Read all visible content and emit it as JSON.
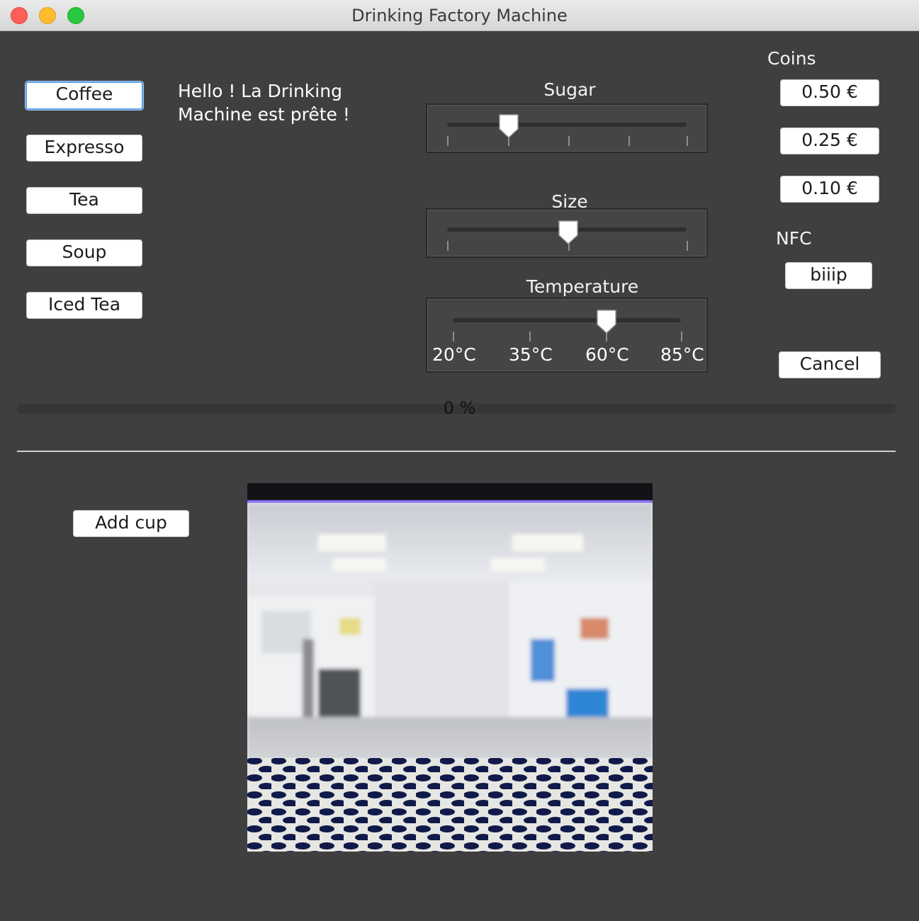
{
  "window": {
    "title": "Drinking Factory Machine"
  },
  "drinks": [
    "Coffee",
    "Expresso",
    "Tea",
    "Soup",
    "Iced Tea"
  ],
  "message": {
    "line1": "Hello ! La Drinking",
    "line2": "Machine est prête !"
  },
  "sliders": {
    "sugar": {
      "label": "Sugar",
      "value": 1,
      "min": 0,
      "max": 4
    },
    "size": {
      "label": "Size",
      "value": 1,
      "min": 0,
      "max": 2
    },
    "temperature": {
      "label": "Temperature",
      "value": 2,
      "min": 0,
      "max": 3,
      "tick_labels": [
        "20°C",
        "35°C",
        "60°C",
        "85°C"
      ]
    }
  },
  "coins": {
    "label": "Coins",
    "buttons": [
      "0.50 €",
      "0.25 €",
      "0.10 €"
    ]
  },
  "nfc": {
    "label": "NFC",
    "button": "biiip"
  },
  "cancel": {
    "label": "Cancel"
  },
  "progress": {
    "text": "0 %",
    "value": 0
  },
  "cup": {
    "add_label": "Add cup"
  }
}
